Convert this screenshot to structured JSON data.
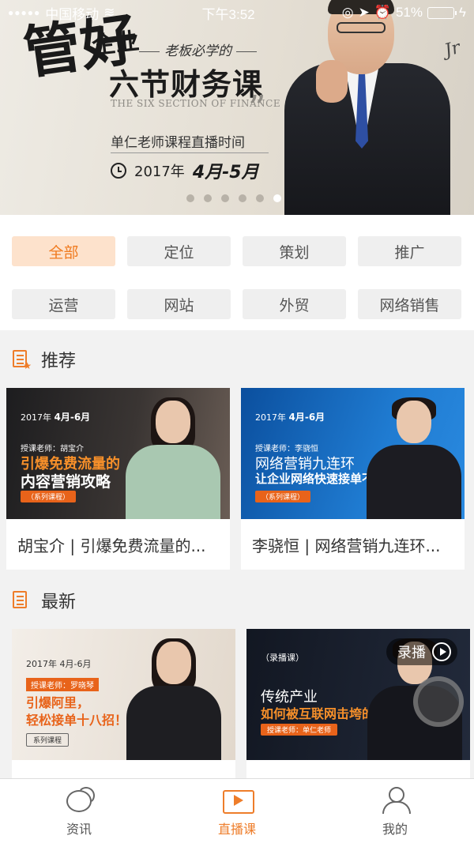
{
  "status_bar": {
    "carrier": "中国移动",
    "time": "下午3:52",
    "battery": "51%",
    "icons": [
      "signal-dots-icon",
      "wifi-icon",
      "lock-rotation-icon",
      "location-icon",
      "alarm-icon",
      "battery-icon",
      "charging-icon"
    ]
  },
  "banner": {
    "brush_title": "管好",
    "brush_small": "企业",
    "subtitle": "老板必学的",
    "main_title": "六节财务课",
    "english": "THE SIX SECTION OF FINANCE",
    "live_text": "单仁老师课程直播时间",
    "year": "2017年",
    "months": "4月-5月",
    "signature": "Jr",
    "slide_count": 6,
    "active_slide": 6
  },
  "categories": [
    {
      "label": "全部",
      "active": true
    },
    {
      "label": "定位",
      "active": false
    },
    {
      "label": "策划",
      "active": false
    },
    {
      "label": "推广",
      "active": false
    },
    {
      "label": "运营",
      "active": false
    },
    {
      "label": "网站",
      "active": false
    },
    {
      "label": "外贸",
      "active": false
    },
    {
      "label": "网络销售",
      "active": false
    }
  ],
  "recommended": {
    "title": "推荐",
    "cards": [
      {
        "title": "胡宝介 | 引爆免费流量的...",
        "thumb": {
          "date_prefix": "2017年",
          "date": "4月-6月",
          "teacher": "授课老师：胡宝介",
          "line1": "引爆免费流量的",
          "line2": "内容营销攻略",
          "tag": "（系列课程）"
        }
      },
      {
        "title": "李骁恒 | 网络营销九连环...",
        "thumb": {
          "date_prefix": "2017年",
          "date": "4月-6月",
          "teacher": "授课老师：李骁恒",
          "line1": "网络营销九连环",
          "line2": "让企业网络快速接单不烧钱",
          "tag": "（系列课程）"
        }
      }
    ]
  },
  "latest": {
    "title": "最新",
    "cards": [
      {
        "thumb": {
          "date": "2017年  4月-6月",
          "teacher": "授课老师：罗晓琴",
          "line1": "引爆阿里，",
          "line2": "轻松接单十八招！",
          "tag": "系列课程"
        }
      },
      {
        "thumb": {
          "badge": "录播",
          "kind": "（录播课）",
          "line1": "传统产业",
          "line2": "如何被互联网击垮的",
          "teacher": "授课老师：单仁老师"
        }
      }
    ]
  },
  "tab_bar": {
    "tabs": [
      {
        "label": "资讯",
        "icon": "chat-bubbles-icon",
        "active": false
      },
      {
        "label": "直播课",
        "icon": "live-play-icon",
        "active": true
      },
      {
        "label": "我的",
        "icon": "user-icon",
        "active": false
      }
    ]
  },
  "colors": {
    "accent": "#ee7d2a",
    "active_chip_bg": "#fde2cc",
    "battery": "#f6c000"
  }
}
